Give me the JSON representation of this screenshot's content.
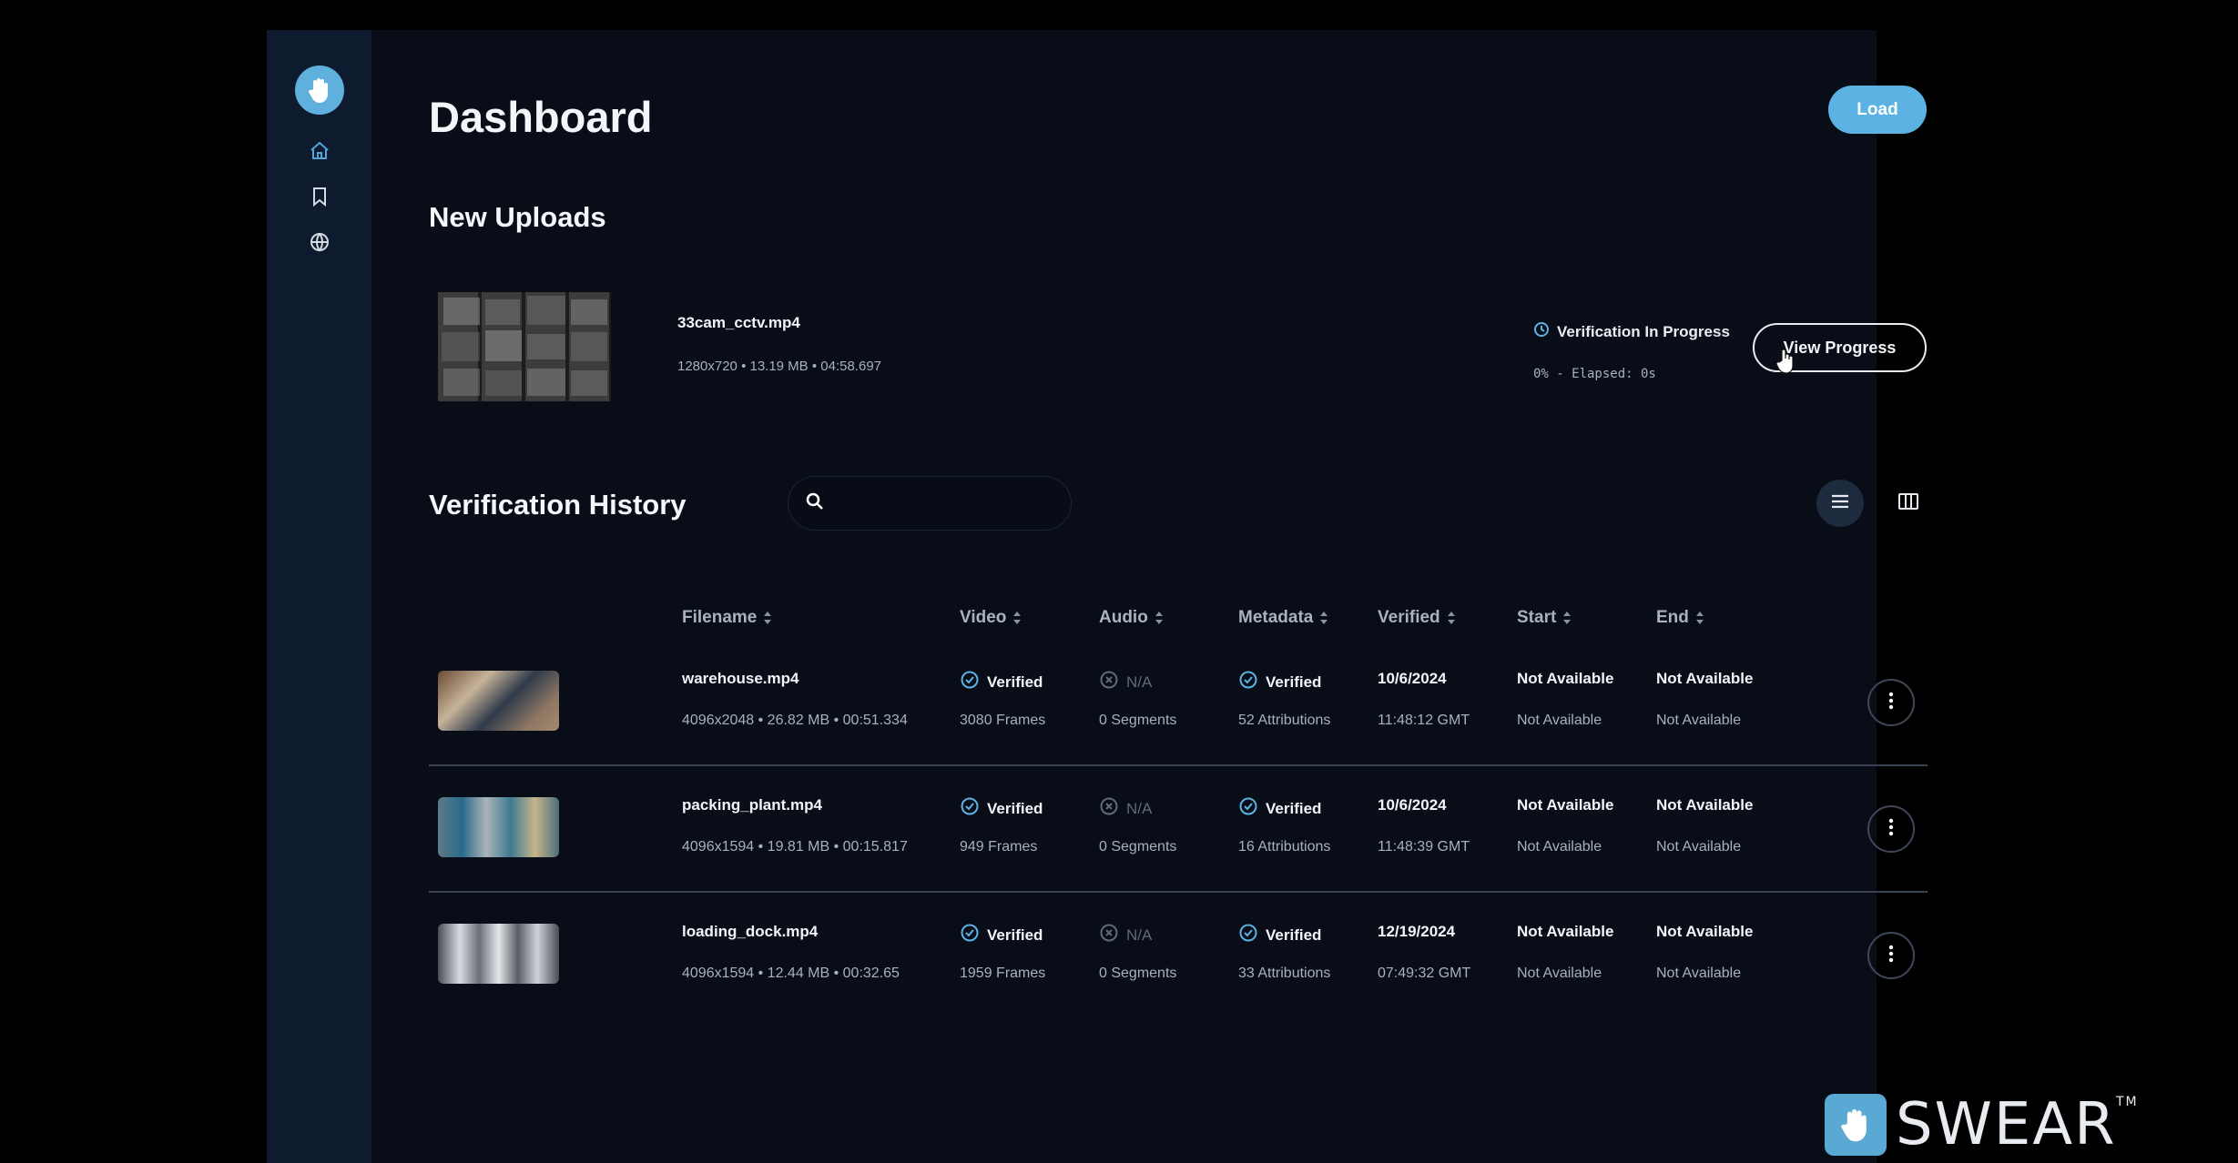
{
  "header": {
    "title": "Dashboard",
    "load_label": "Load"
  },
  "sidebar": {
    "items": [
      {
        "icon": "home-icon"
      },
      {
        "icon": "bookmark-icon"
      },
      {
        "icon": "globe-icon"
      }
    ]
  },
  "new_uploads": {
    "title": "New Uploads",
    "item": {
      "filename": "33cam_cctv.mp4",
      "meta": "1280x720 • 13.19 MB • 04:58.697",
      "status": "Verification In Progress",
      "progress": "0% - Elapsed: 0s",
      "progress_fraction": 0,
      "button_label": "View Progress"
    }
  },
  "history": {
    "title": "Verification History",
    "search_placeholder": "",
    "columns": [
      "Filename",
      "Video",
      "Audio",
      "Metadata",
      "Verified",
      "Start",
      "End"
    ],
    "rows": [
      {
        "filename": "warehouse.mp4",
        "meta": "4096x2048 • 26.82 MB • 00:51.334",
        "video": "Verified",
        "video_sub": "3080 Frames",
        "audio": "N/A",
        "audio_sub": "0 Segments",
        "metadata": "Verified",
        "metadata_sub": "52 Attributions",
        "verified_date": "10/6/2024",
        "verified_time": "11:48:12 GMT",
        "start": "Not Available",
        "start_sub": "Not Available",
        "end": "Not Available",
        "end_sub": "Not Available"
      },
      {
        "filename": "packing_plant.mp4",
        "meta": "4096x1594 • 19.81 MB • 00:15.817",
        "video": "Verified",
        "video_sub": "949 Frames",
        "audio": "N/A",
        "audio_sub": "0 Segments",
        "metadata": "Verified",
        "metadata_sub": "16 Attributions",
        "verified_date": "10/6/2024",
        "verified_time": "11:48:39 GMT",
        "start": "Not Available",
        "start_sub": "Not Available",
        "end": "Not Available",
        "end_sub": "Not Available"
      },
      {
        "filename": "loading_dock.mp4",
        "meta": "4096x1594 • 12.44 MB • 00:32.65",
        "video": "Verified",
        "video_sub": "1959 Frames",
        "audio": "N/A",
        "audio_sub": "0 Segments",
        "metadata": "Verified",
        "metadata_sub": "33 Attributions",
        "verified_date": "12/19/2024",
        "verified_time": "07:49:32 GMT",
        "start": "Not Available",
        "start_sub": "Not Available",
        "end": "Not Available",
        "end_sub": "Not Available"
      }
    ]
  },
  "brand": {
    "name": "SWEAR",
    "tm": "TM"
  },
  "colors": {
    "accent": "#5cb3e3",
    "background": "#080d18",
    "sidebar": "#0e1a2d",
    "verified": "#5cb3e3",
    "muted": "#a8b1bf"
  }
}
